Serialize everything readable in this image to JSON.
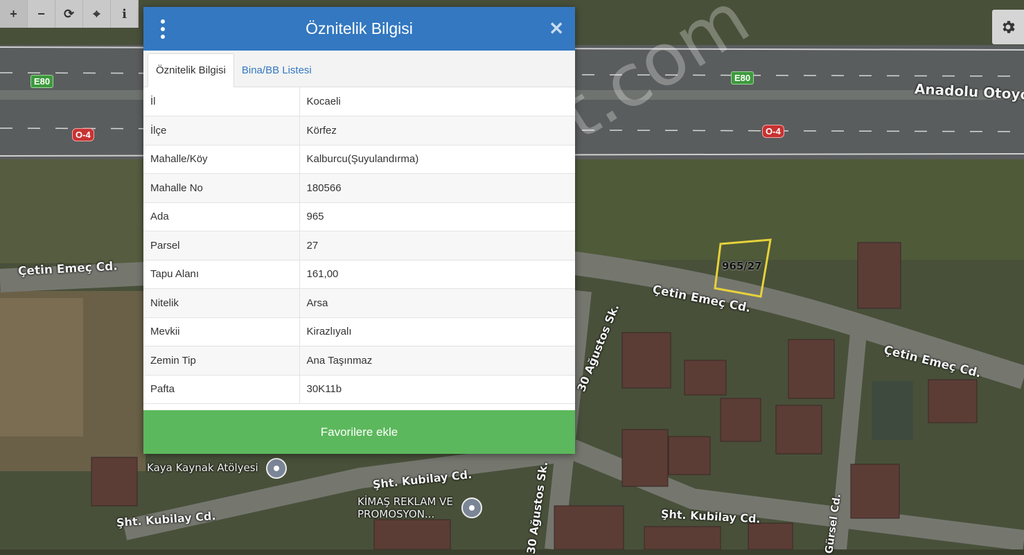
{
  "toolbar": {
    "buttons": [
      {
        "name": "zoom-in-icon",
        "glyph": "+"
      },
      {
        "name": "zoom-out-icon",
        "glyph": "−"
      },
      {
        "name": "refresh-icon",
        "glyph": "⟳"
      },
      {
        "name": "locate-icon",
        "glyph": "⌖"
      },
      {
        "name": "info-icon",
        "glyph": "i"
      }
    ]
  },
  "settings": {
    "icon": "gear-icon"
  },
  "dialog": {
    "title": "Öznitelik Bilgisi",
    "menu_icon": "vertical-dots-icon",
    "close_icon": "close-icon",
    "tabs": [
      {
        "label": "Öznitelik Bilgisi",
        "active": true
      },
      {
        "label": "Bina/BB Listesi",
        "active": false
      }
    ],
    "rows": [
      {
        "key": "İl",
        "value": "Kocaeli"
      },
      {
        "key": "İlçe",
        "value": "Körfez"
      },
      {
        "key": "Mahalle/Köy",
        "value": "Kalburcu(Şuyulandırma)"
      },
      {
        "key": "Mahalle No",
        "value": "180566"
      },
      {
        "key": "Ada",
        "value": "965"
      },
      {
        "key": "Parsel",
        "value": "27"
      },
      {
        "key": "Tapu Alanı",
        "value": "161,00"
      },
      {
        "key": "Nitelik",
        "value": "Arsa"
      },
      {
        "key": "Mevkii",
        "value": "Kirazlıyalı"
      },
      {
        "key": "Zemin Tip",
        "value": "Ana Taşınmaz"
      },
      {
        "key": "Pafta",
        "value": "30K11b"
      }
    ],
    "favorite_button": "Favorilere ekle"
  },
  "map": {
    "road_labels": {
      "anadolu": "Anadolu Otoyolu",
      "cetin_left": "Çetin Emeç Cd.",
      "cetin_mid": "Çetin Emeç Cd.",
      "cetin_right": "Çetin Emeç Cd.",
      "agustos_upper": "30 Ağustos Sk.",
      "agustos_lower": "30 Ağustos Sk.",
      "kubilay_mid": "Şht. Kubilay Cd.",
      "kubilay_left": "Şht. Kubilay Cd.",
      "kubilay_right": "Şht. Kubilay Cd.",
      "gursel": "Gürsel Cd."
    },
    "shields": {
      "e80_left": "E80",
      "e80_right": "E80",
      "o4_left": "O-4",
      "o4_right": "O-4"
    },
    "parcel_label": "965/27",
    "pois": {
      "kaya": "Kaya Kaynak Atölyesi",
      "kimas": "KİMAŞ REKLAM VE PROMOSYON..."
    },
    "watermark": "emlakjet.com"
  }
}
